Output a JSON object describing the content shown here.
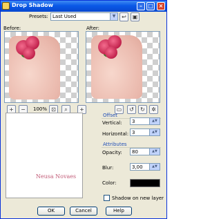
{
  "window": {
    "title": "Drop Shadow"
  },
  "presets": {
    "label": "Presets:",
    "value": "Last Used"
  },
  "previews": {
    "before_label": "Before:",
    "after_label": "After:"
  },
  "zoom": {
    "value": "100%"
  },
  "offset": {
    "group_label": "Offset",
    "vertical_label": "Vertical:",
    "vertical_value": "3",
    "horizontal_label": "Horizontal:",
    "horizontal_value": "3"
  },
  "attributes": {
    "group_label": "Attributes",
    "opacity_label": "Opacity:",
    "opacity_value": "80",
    "blur_label": "Blur:",
    "blur_value": "3,00",
    "color_label": "Color:",
    "color_hex": "#000000"
  },
  "shadow_checkbox": {
    "label": "Shadow on new layer",
    "checked": false
  },
  "buttons": {
    "ok": "OK",
    "cancel": "Cancel",
    "help": "Help"
  },
  "watermark": {
    "text": "Neusa Novaes"
  }
}
